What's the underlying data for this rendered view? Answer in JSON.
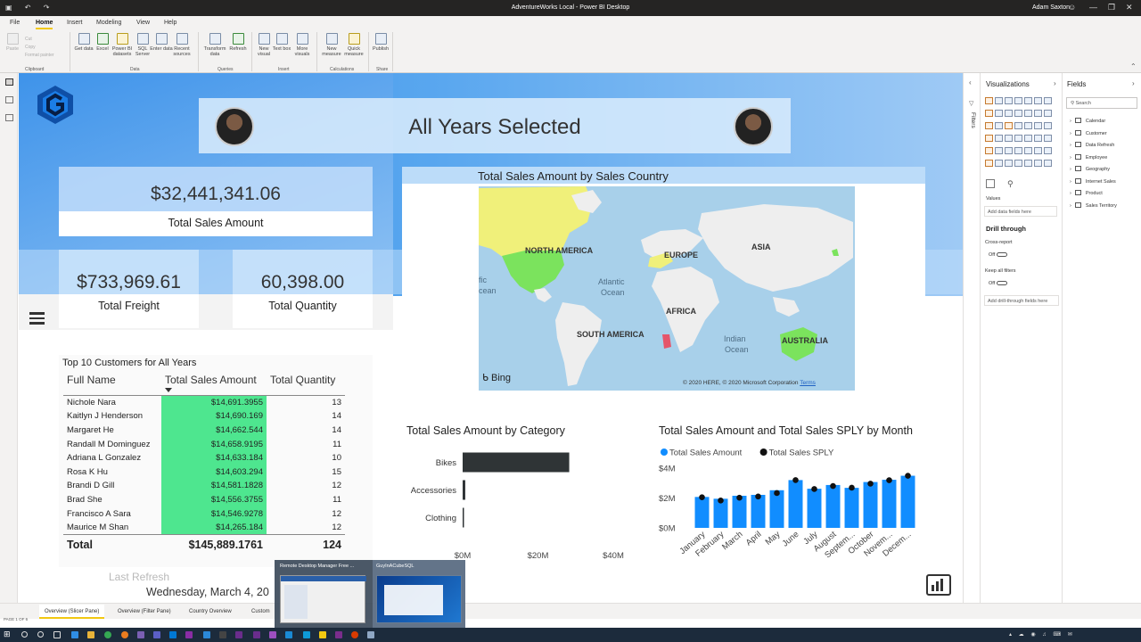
{
  "window": {
    "title": "AdventureWorks Local - Power BI Desktop",
    "user": "Adam Saxton"
  },
  "menu": {
    "tabs": [
      "File",
      "Home",
      "Insert",
      "Modeling",
      "View",
      "Help"
    ],
    "active": "Home"
  },
  "ribbon": {
    "clipboard": {
      "paste": "Paste",
      "cut": "Cut",
      "copy": "Copy",
      "format_painter": "Format painter",
      "group": "Clipboard"
    },
    "data": {
      "get_data": "Get data",
      "excel": "Excel",
      "pbi_datasets": "Power BI datasets",
      "sql_server": "SQL Server",
      "enter_data": "Enter data",
      "recent_sources": "Recent sources",
      "group": "Data"
    },
    "queries": {
      "transform": "Transform data",
      "refresh": "Refresh",
      "group": "Queries"
    },
    "insert": {
      "new_visual": "New visual",
      "text_box": "Text box",
      "more_visuals": "More visuals",
      "group": "Insert"
    },
    "calculations": {
      "new_measure": "New measure",
      "quick_measure": "Quick measure",
      "group": "Calculations"
    },
    "share": {
      "publish": "Publish",
      "group": "Share"
    }
  },
  "report": {
    "header_title": "All Years Selected",
    "kpis": {
      "sales": {
        "value": "$32,441,341.06",
        "label": "Total Sales Amount"
      },
      "freight": {
        "value": "$733,969.61",
        "label": "Total Freight"
      },
      "quantity": {
        "value": "60,398.00",
        "label": "Total Quantity"
      }
    },
    "top10": {
      "title": "Top 10 Customers for All Years",
      "columns": [
        "Full Name",
        "Total Sales Amount",
        "Total Quantity"
      ],
      "rows": [
        [
          "Nichole Nara",
          "$14,691.3955",
          "13"
        ],
        [
          "Kaitlyn J Henderson",
          "$14,690.169",
          "14"
        ],
        [
          "Margaret He",
          "$14,662.544",
          "14"
        ],
        [
          "Randall M Dominguez",
          "$14,658.9195",
          "11"
        ],
        [
          "Adriana L Gonzalez",
          "$14,633.184",
          "10"
        ],
        [
          "Rosa K Hu",
          "$14,603.294",
          "15"
        ],
        [
          "Brandi D Gill",
          "$14,581.1828",
          "12"
        ],
        [
          "Brad She",
          "$14,556.3755",
          "11"
        ],
        [
          "Francisco A Sara",
          "$14,546.9278",
          "12"
        ],
        [
          "Maurice M Shan",
          "$14,265.184",
          "12"
        ]
      ],
      "total": [
        "Total",
        "$145,889.1761",
        "124"
      ]
    },
    "map": {
      "title": "Total Sales Amount by Sales Country",
      "labels": {
        "north_america": "NORTH AMERICA",
        "europe": "EUROPE",
        "asia": "ASIA",
        "africa": "AFRICA",
        "south_america": "SOUTH AMERICA",
        "australia": "AUSTRALIA",
        "atlantic": "Atlantic",
        "atlantic2": "Ocean",
        "indian": "Indian",
        "indian2": "Ocean",
        "pacific": "fic",
        "pacific2": "cean"
      },
      "brand": "Bing",
      "copyright": "© 2020 HERE, © 2020 Microsoft Corporation",
      "terms": "Terms"
    },
    "last_refresh_label": "Last Refresh",
    "last_refresh_date": "Wednesday, March 4, 20"
  },
  "chart_data": [
    {
      "type": "bar",
      "title": "Total Sales Amount by Category",
      "categories": [
        "Bikes",
        "Accessories",
        "Clothing"
      ],
      "values": [
        28.3,
        0.7,
        0.34
      ],
      "xlabel": "",
      "ylabel": "",
      "xlim": [
        0,
        40
      ],
      "ticks": [
        "$0M",
        "$20M",
        "$40M"
      ],
      "color": "#2f3436"
    },
    {
      "type": "bar",
      "title": "Total Sales Amount and Total Sales SPLY by Month",
      "categories": [
        "January",
        "February",
        "March",
        "April",
        "May",
        "June",
        "July",
        "August",
        "Septem...",
        "October",
        "Novem...",
        "Decem..."
      ],
      "series": [
        {
          "name": "Total Sales Amount",
          "values": [
            2.07,
            1.95,
            2.15,
            2.21,
            2.52,
            3.2,
            2.62,
            2.87,
            2.68,
            3.07,
            3.22,
            3.49
          ],
          "color": "#118dff",
          "kind": "bar"
        },
        {
          "name": "Total Sales SPLY",
          "values": [
            2.05,
            1.83,
            2.02,
            2.1,
            2.33,
            3.2,
            2.6,
            2.8,
            2.69,
            2.96,
            3.19,
            3.49
          ],
          "color": "#111111",
          "kind": "marker"
        }
      ],
      "ylim": [
        0,
        4
      ],
      "ticks": [
        "$0M",
        "$2M",
        "$4M"
      ],
      "legend": "top-left"
    }
  ],
  "visualizations": {
    "title": "Visualizations",
    "values_label": "Values",
    "values_placeholder": "Add data fields here",
    "drill_through": "Drill through",
    "cross_report": "Cross-report",
    "cross_report_state": "Off",
    "keep_filters": "Keep all filters",
    "keep_filters_state": "Off",
    "drill_placeholder": "Add drill-through fields here"
  },
  "filters_label": "Filters",
  "fields": {
    "title": "Fields",
    "search_placeholder": "Search",
    "tables": [
      "Calendar",
      "Customer",
      "Data Refresh",
      "Employee",
      "Geography",
      "Internet Sales",
      "Product",
      "Sales Territory"
    ]
  },
  "pages": {
    "tabs": [
      "Overview (Slicer Pane)",
      "Overview (Filter Pane)",
      "Country Overview",
      "Custom"
    ],
    "active": 0,
    "page_count": "PAGE 1 OF 6"
  },
  "preview": {
    "windows": [
      "Remote Desktop Manager Free ...",
      "GuyInACubeSQL"
    ]
  },
  "colors": {
    "accent": "#f2c811",
    "highlight": "#4ee68f",
    "series": "#118dff"
  }
}
